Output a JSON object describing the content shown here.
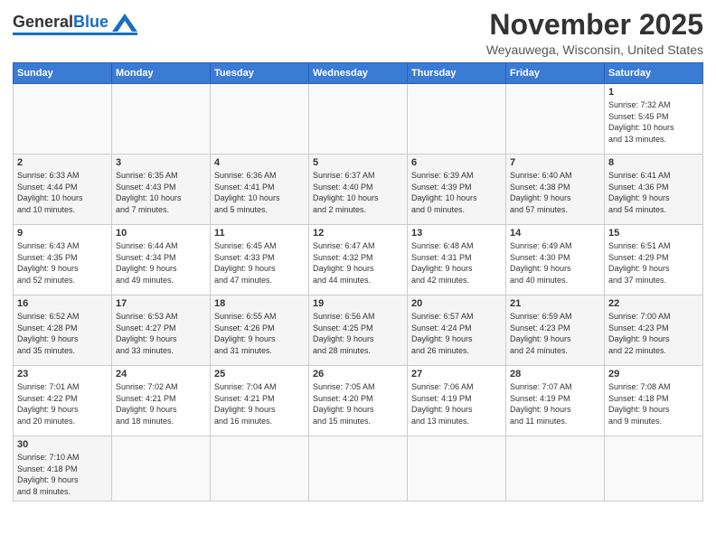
{
  "header": {
    "logo_general": "General",
    "logo_blue": "Blue",
    "month_title": "November 2025",
    "location": "Weyauwega, Wisconsin, United States"
  },
  "weekdays": [
    "Sunday",
    "Monday",
    "Tuesday",
    "Wednesday",
    "Thursday",
    "Friday",
    "Saturday"
  ],
  "weeks": [
    [
      {
        "day": "",
        "info": ""
      },
      {
        "day": "",
        "info": ""
      },
      {
        "day": "",
        "info": ""
      },
      {
        "day": "",
        "info": ""
      },
      {
        "day": "",
        "info": ""
      },
      {
        "day": "",
        "info": ""
      },
      {
        "day": "1",
        "info": "Sunrise: 7:32 AM\nSunset: 5:45 PM\nDaylight: 10 hours\nand 13 minutes."
      }
    ],
    [
      {
        "day": "2",
        "info": "Sunrise: 6:33 AM\nSunset: 4:44 PM\nDaylight: 10 hours\nand 10 minutes."
      },
      {
        "day": "3",
        "info": "Sunrise: 6:35 AM\nSunset: 4:43 PM\nDaylight: 10 hours\nand 7 minutes."
      },
      {
        "day": "4",
        "info": "Sunrise: 6:36 AM\nSunset: 4:41 PM\nDaylight: 10 hours\nand 5 minutes."
      },
      {
        "day": "5",
        "info": "Sunrise: 6:37 AM\nSunset: 4:40 PM\nDaylight: 10 hours\nand 2 minutes."
      },
      {
        "day": "6",
        "info": "Sunrise: 6:39 AM\nSunset: 4:39 PM\nDaylight: 10 hours\nand 0 minutes."
      },
      {
        "day": "7",
        "info": "Sunrise: 6:40 AM\nSunset: 4:38 PM\nDaylight: 9 hours\nand 57 minutes."
      },
      {
        "day": "8",
        "info": "Sunrise: 6:41 AM\nSunset: 4:36 PM\nDaylight: 9 hours\nand 54 minutes."
      }
    ],
    [
      {
        "day": "9",
        "info": "Sunrise: 6:43 AM\nSunset: 4:35 PM\nDaylight: 9 hours\nand 52 minutes."
      },
      {
        "day": "10",
        "info": "Sunrise: 6:44 AM\nSunset: 4:34 PM\nDaylight: 9 hours\nand 49 minutes."
      },
      {
        "day": "11",
        "info": "Sunrise: 6:45 AM\nSunset: 4:33 PM\nDaylight: 9 hours\nand 47 minutes."
      },
      {
        "day": "12",
        "info": "Sunrise: 6:47 AM\nSunset: 4:32 PM\nDaylight: 9 hours\nand 44 minutes."
      },
      {
        "day": "13",
        "info": "Sunrise: 6:48 AM\nSunset: 4:31 PM\nDaylight: 9 hours\nand 42 minutes."
      },
      {
        "day": "14",
        "info": "Sunrise: 6:49 AM\nSunset: 4:30 PM\nDaylight: 9 hours\nand 40 minutes."
      },
      {
        "day": "15",
        "info": "Sunrise: 6:51 AM\nSunset: 4:29 PM\nDaylight: 9 hours\nand 37 minutes."
      }
    ],
    [
      {
        "day": "16",
        "info": "Sunrise: 6:52 AM\nSunset: 4:28 PM\nDaylight: 9 hours\nand 35 minutes."
      },
      {
        "day": "17",
        "info": "Sunrise: 6:53 AM\nSunset: 4:27 PM\nDaylight: 9 hours\nand 33 minutes."
      },
      {
        "day": "18",
        "info": "Sunrise: 6:55 AM\nSunset: 4:26 PM\nDaylight: 9 hours\nand 31 minutes."
      },
      {
        "day": "19",
        "info": "Sunrise: 6:56 AM\nSunset: 4:25 PM\nDaylight: 9 hours\nand 28 minutes."
      },
      {
        "day": "20",
        "info": "Sunrise: 6:57 AM\nSunset: 4:24 PM\nDaylight: 9 hours\nand 26 minutes."
      },
      {
        "day": "21",
        "info": "Sunrise: 6:59 AM\nSunset: 4:23 PM\nDaylight: 9 hours\nand 24 minutes."
      },
      {
        "day": "22",
        "info": "Sunrise: 7:00 AM\nSunset: 4:23 PM\nDaylight: 9 hours\nand 22 minutes."
      }
    ],
    [
      {
        "day": "23",
        "info": "Sunrise: 7:01 AM\nSunset: 4:22 PM\nDaylight: 9 hours\nand 20 minutes."
      },
      {
        "day": "24",
        "info": "Sunrise: 7:02 AM\nSunset: 4:21 PM\nDaylight: 9 hours\nand 18 minutes."
      },
      {
        "day": "25",
        "info": "Sunrise: 7:04 AM\nSunset: 4:21 PM\nDaylight: 9 hours\nand 16 minutes."
      },
      {
        "day": "26",
        "info": "Sunrise: 7:05 AM\nSunset: 4:20 PM\nDaylight: 9 hours\nand 15 minutes."
      },
      {
        "day": "27",
        "info": "Sunrise: 7:06 AM\nSunset: 4:19 PM\nDaylight: 9 hours\nand 13 minutes."
      },
      {
        "day": "28",
        "info": "Sunrise: 7:07 AM\nSunset: 4:19 PM\nDaylight: 9 hours\nand 11 minutes."
      },
      {
        "day": "29",
        "info": "Sunrise: 7:08 AM\nSunset: 4:18 PM\nDaylight: 9 hours\nand 9 minutes."
      }
    ],
    [
      {
        "day": "30",
        "info": "Sunrise: 7:10 AM\nSunset: 4:18 PM\nDaylight: 9 hours\nand 8 minutes."
      },
      {
        "day": "",
        "info": ""
      },
      {
        "day": "",
        "info": ""
      },
      {
        "day": "",
        "info": ""
      },
      {
        "day": "",
        "info": ""
      },
      {
        "day": "",
        "info": ""
      },
      {
        "day": "",
        "info": ""
      }
    ]
  ]
}
